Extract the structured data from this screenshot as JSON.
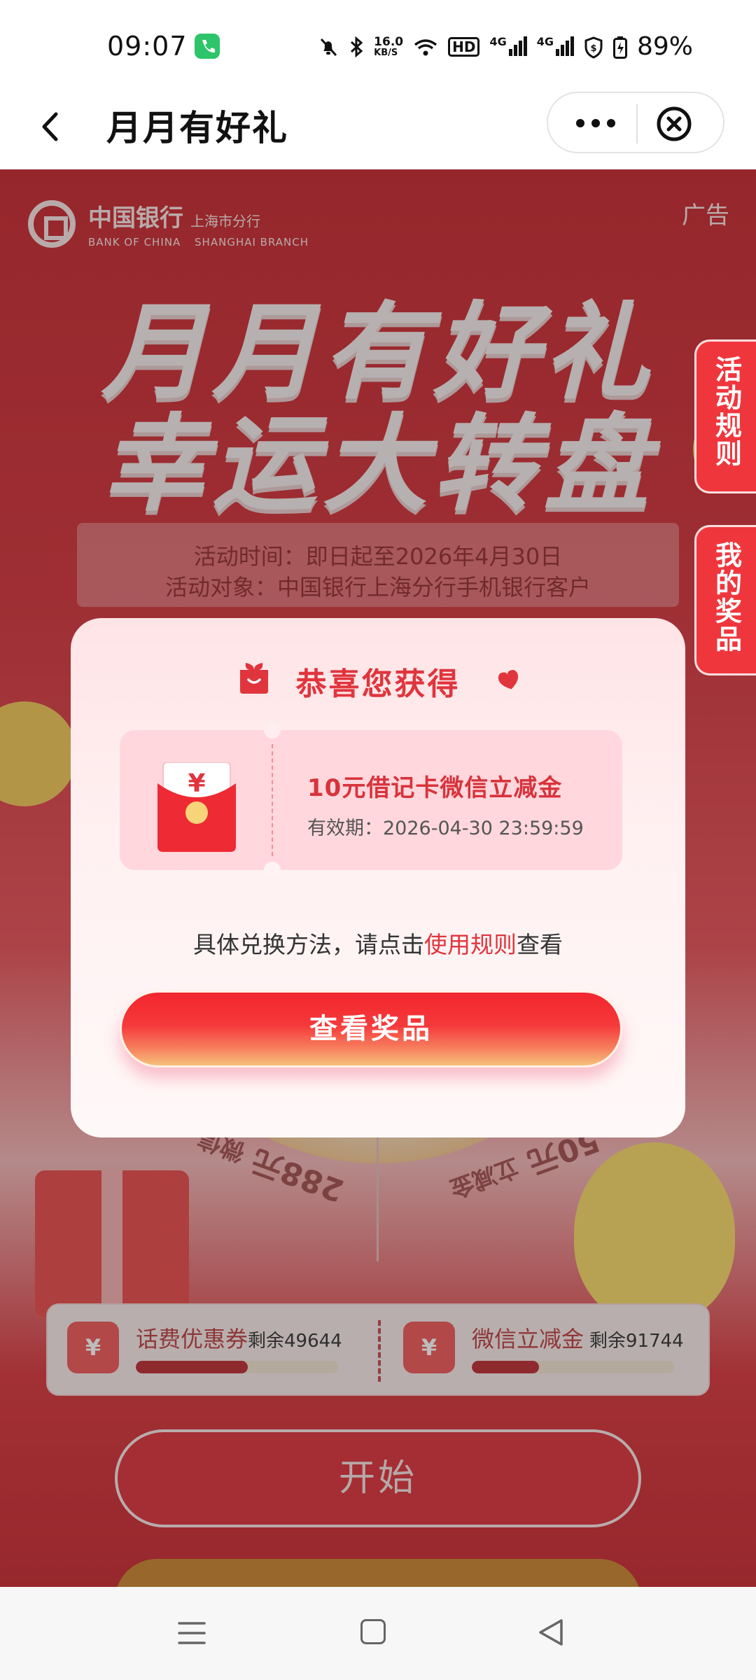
{
  "status_bar": {
    "time": "09:07",
    "net_speed_value": "16.0",
    "net_speed_unit": "KB/S",
    "hd_label": "HD",
    "signal_1": "4G",
    "signal_2": "4G",
    "battery": "89%"
  },
  "title_bar": {
    "title": "月月有好礼"
  },
  "page": {
    "bank_name": "中国银行",
    "bank_name_en": "BANK OF CHINA",
    "branch": "上海市分行",
    "branch_en": "SHANGHAI BRANCH",
    "ad_label": "广告",
    "hero_line_1": "月月有好礼",
    "hero_line_2": "幸运大转盘",
    "activity_time": "活动时间：即日起至2026年4月30日",
    "activity_target": "活动对象：中国银行上海分行手机银行客户",
    "side_tab_rules": "活动规则",
    "side_tab_prizes": "我的奖品",
    "wheel_text_left": "288元",
    "wheel_text_left_sub": "微信",
    "wheel_text_right": "50元",
    "wheel_text_right_sub": "立减金",
    "balance": [
      {
        "icon": "¥",
        "name": "话费优惠券",
        "remain": "剩余49644",
        "fill": 0.55
      },
      {
        "icon": "¥",
        "name": "微信立减金",
        "remain": "剩余91744",
        "fill": 0.33
      }
    ],
    "start_label": "开始"
  },
  "modal": {
    "title": "恭喜您获得",
    "prize_name": "10元借记卡微信立减金",
    "prize_expire": "有效期：2026-04-30 23:59:59",
    "envelope_symbol": "¥",
    "rule_prefix": "具体兑换方法，请点击",
    "rule_link": "使用规则",
    "rule_suffix": "查看",
    "view_button": "查看奖品"
  },
  "colors": {
    "brand_red": "#e0353d",
    "call_green": "#2ec46a"
  }
}
